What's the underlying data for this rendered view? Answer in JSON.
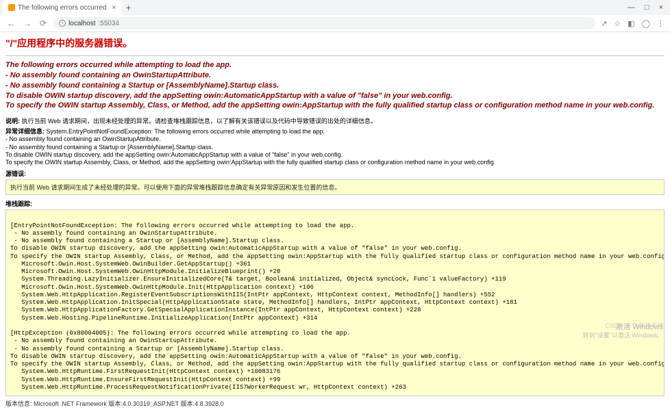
{
  "browser": {
    "tab_title": "The following errors occurred",
    "url_host": "localhost",
    "url_port": ":55034"
  },
  "page": {
    "title": "\"/\"应用程序中的服务器错误。",
    "err_lines": [
      "The following errors occurred while attempting to load the app.",
      "- No assembly found containing an OwinStartupAttribute.",
      "- No assembly found containing a Startup or [AssemblyName].Startup class.",
      "To disable OWIN startup discovery, add the appSetting owin:AutomaticAppStartup with a value of \"false\" in your web.config.",
      "To specify the OWIN startup Assembly, Class, or Method, add the appSetting owin:AppStartup with the fully qualified startup class or configuration method name in your web.config."
    ],
    "desc_label": "说明:",
    "desc_text": "执行当前 Web 请求期间，出现未经处理的异常。请检查堆栈跟踪信息，以了解有关该错误以及代码中导致错误的出处的详细信息。",
    "exc_label": "异常详细信息:",
    "exc_text": "System.EntryPointNotFoundException: The following errors occurred while attempting to load the app.\n- No assembly found containing an OwinStartupAttribute.\n- No assembly found containing a Startup or [AssemblyName].Startup class.\nTo disable OWIN startup discovery, add the appSetting owin:AutomaticAppStartup with a value of \"false\" in your web.config.\nTo specify the OWIN startup Assembly, Class, or Method, add the appSetting owin:AppStartup with the fully qualified startup class or configuration method name in your web.config.",
    "src_label": "源错误:",
    "src_text": "执行当前 Web 请求期间生成了未经处理的异常。可以使用下面的异常堆栈跟踪信息确定有关异常原因和发生位置的信息。",
    "stack_label": "堆栈跟踪:",
    "stack_text": "\n[EntryPointNotFoundException: The following errors occurred while attempting to load the app.\n - No assembly found containing an OwinStartupAttribute.\n - No assembly found containing a Startup or [AssemblyName].Startup class.\nTo disable OWIN startup discovery, add the appSetting owin:AutomaticAppStartup with a value of \"false\" in your web.config.\nTo specify the OWIN startup Assembly, Class, or Method, add the appSetting owin:AppStartup with the fully qualified startup class or configuration method name in your web.config.]\n   Microsoft.Owin.Host.SystemWeb.OwinBuilder.GetAppStartup() +361\n   Microsoft.Owin.Host.SystemWeb.OwinHttpModule.InitializeBlueprint() +28\n   System.Threading.LazyInitializer.EnsureInitializedCore(T& target, Boolean& initialized, Object& syncLock, Func`1 valueFactory) +119\n   Microsoft.Owin.Host.SystemWeb.OwinHttpModule.Init(HttpApplication context) +106\n   System.Web.HttpApplication.RegisterEventSubscriptionsWithIIS(IntPtr appContext, HttpContext context, MethodInfo[] handlers) +552\n   System.Web.HttpApplication.InitSpecial(HttpApplicationState state, MethodInfo[] handlers, IntPtr appContext, HttpContext context) +181\n   System.Web.HttpApplicationFactory.GetSpecialApplicationInstance(IntPtr appContext, HttpContext context) +228\n   System.Web.Hosting.PipelineRuntime.InitializeApplication(IntPtr appContext) +314\n\n[HttpException (0x80004005): The following errors occurred while attempting to load the app.\n - No assembly found containing an OwinStartupAttribute.\n - No assembly found containing a Startup or [AssemblyName].Startup class.\nTo disable OWIN startup discovery, add the appSetting owin:AutomaticAppStartup with a value of \"false\" in your web.config.\nTo specify the OWIN startup Assembly, Class, or Method, add the appSetting owin:AppStartup with the fully qualified startup class or configuration method name in your web.config.]\n   System.Web.HttpRuntime.FirstRequestInit(HttpContext context) +10083176\n   System.Web.HttpRuntime.EnsureFirstRequestInit(HttpContext context) +99\n   System.Web.HttpRuntime.ProcessRequestNotificationPrivate(IIS7WorkerRequest wr, HttpContext context) +263",
    "version": "版本信息: Microsoft .NET Framework 版本:4.0.30319; ASP.NET 版本:4.8.3928.0"
  },
  "watermark": {
    "line1": "激活 Windows",
    "line2": "转到\"设置\"以激活 Windows。",
    "csdn": "CSDN @ 伪装我不帅"
  }
}
